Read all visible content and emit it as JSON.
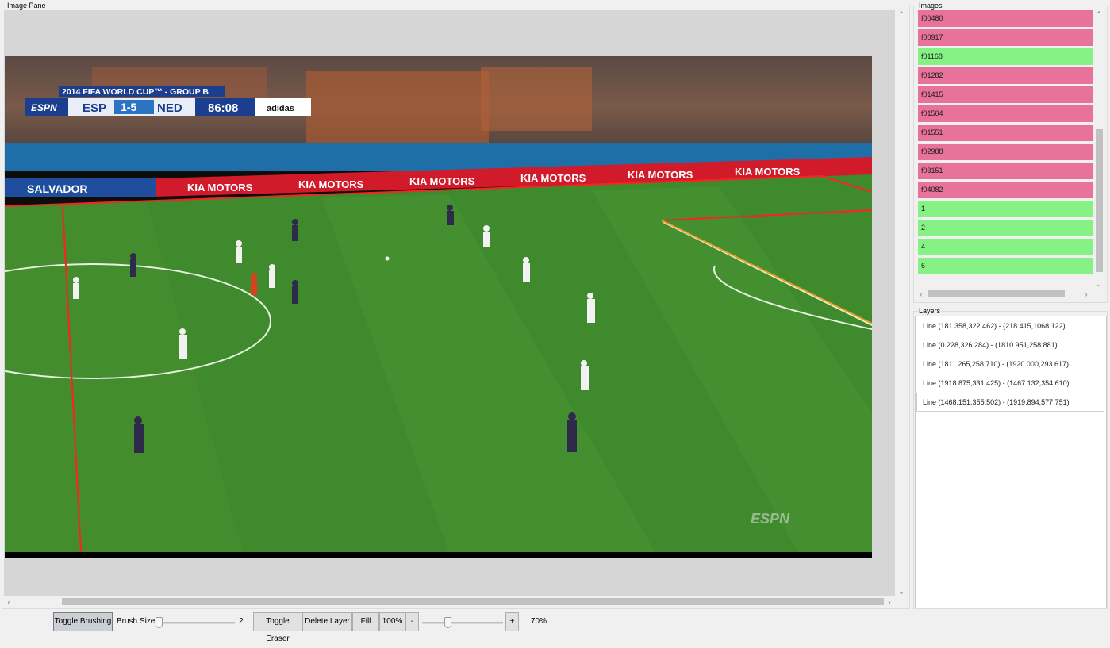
{
  "image_pane": {
    "title": "Image Pane",
    "broadcast": {
      "scorebug_title": "2014 FIFA WORLD CUP™ - GROUP B",
      "network": "ESPN",
      "home_team": "ESP",
      "score": "1-5",
      "away_team": "NED",
      "clock": "86:08",
      "sponsor": "adidas",
      "board_city": "SALVADOR",
      "board_ad": "KIA MOTORS",
      "watermark": "ESPN"
    }
  },
  "images": {
    "title": "Images",
    "items": [
      {
        "label": "f00480",
        "status": "bad"
      },
      {
        "label": "f00917",
        "status": "bad"
      },
      {
        "label": "f01168",
        "status": "good"
      },
      {
        "label": "f01282",
        "status": "bad"
      },
      {
        "label": "f01415",
        "status": "bad"
      },
      {
        "label": "f01504",
        "status": "bad"
      },
      {
        "label": "f01551",
        "status": "bad"
      },
      {
        "label": "f02988",
        "status": "bad"
      },
      {
        "label": "f03151",
        "status": "bad"
      },
      {
        "label": "f04082",
        "status": "bad"
      },
      {
        "label": "1",
        "status": "good"
      },
      {
        "label": "2",
        "status": "good"
      },
      {
        "label": "4",
        "status": "good"
      },
      {
        "label": "6",
        "status": "good"
      }
    ],
    "colors": {
      "bad": "#e8739a",
      "good": "#86f286"
    }
  },
  "layers": {
    "title": "Layers",
    "items": [
      "Line (181.358,322.462) - (218.415,1068.122)",
      "Line (0.228,326.284) - (1810.951,258.881)",
      "Line (1811.265,258.710) - (1920.000,293.617)",
      "Line (1918.875,331.425) - (1467.132,354.610)",
      "Line (1468.151,355.502) - (1919.894,577.751)"
    ],
    "selected_index": 4
  },
  "toolbar": {
    "toggle_brushing": "Toggle Brushing",
    "brush_size_label": "Brush Size:",
    "brush_size_value": "2",
    "brush_size_fraction": 0.0,
    "toggle_eraser": "Toggle Eraser",
    "delete_layer": "Delete Layer",
    "fill": "Fill",
    "zoom_100": "100%",
    "zoom_minus": "-",
    "zoom_plus": "+",
    "zoom_value": "70%",
    "zoom_fraction": 0.3
  }
}
